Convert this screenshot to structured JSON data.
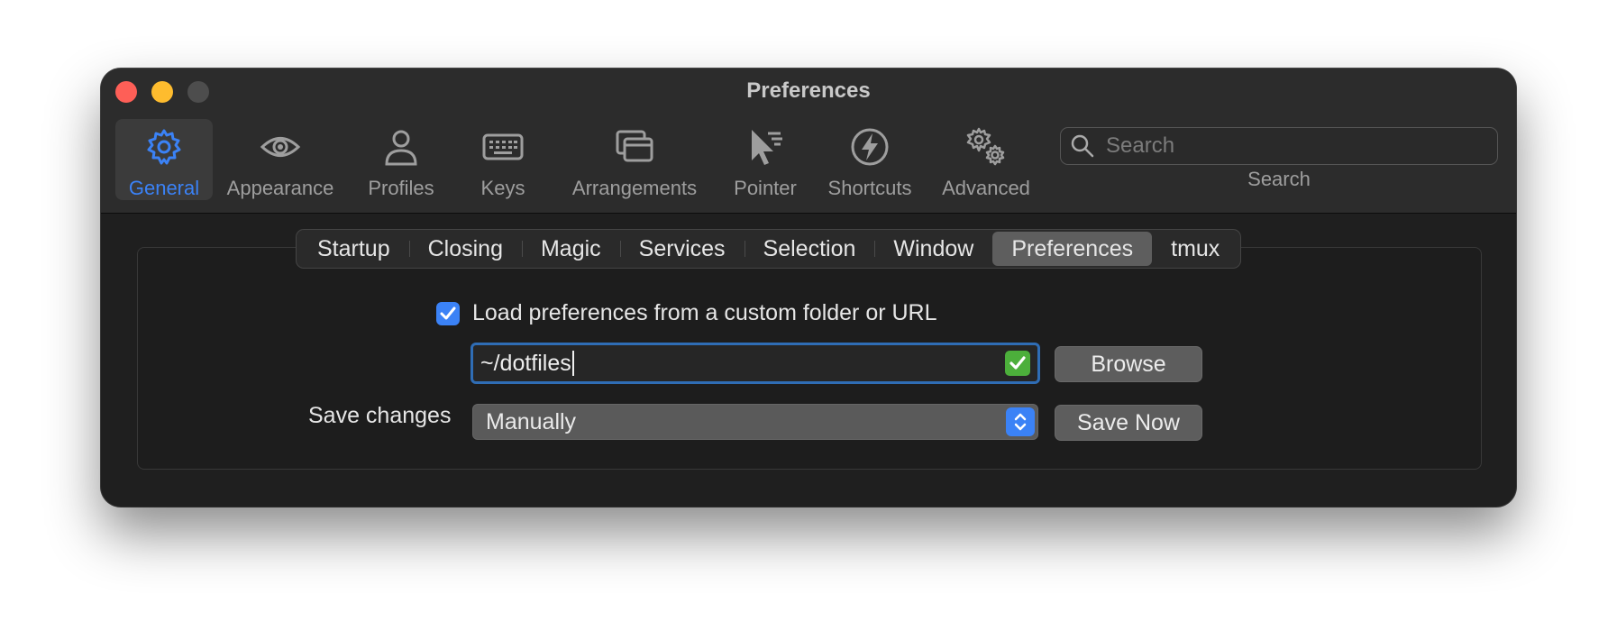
{
  "window": {
    "title": "Preferences"
  },
  "toolbar": {
    "items": [
      {
        "label": "General",
        "icon": "gear-icon",
        "active": true
      },
      {
        "label": "Appearance",
        "icon": "eye-icon"
      },
      {
        "label": "Profiles",
        "icon": "person-icon"
      },
      {
        "label": "Keys",
        "icon": "keyboard-icon"
      },
      {
        "label": "Arrangements",
        "icon": "windows-icon"
      },
      {
        "label": "Pointer",
        "icon": "pointer-icon"
      },
      {
        "label": "Shortcuts",
        "icon": "lightning-icon"
      },
      {
        "label": "Advanced",
        "icon": "gears-icon"
      }
    ],
    "search": {
      "placeholder": "Search",
      "caption": "Search"
    }
  },
  "subtabs": {
    "items": [
      "Startup",
      "Closing",
      "Magic",
      "Services",
      "Selection",
      "Window",
      "Preferences",
      "tmux"
    ],
    "selected": "Preferences"
  },
  "prefs": {
    "load_custom_label": "Load preferences from a custom folder or URL",
    "load_custom_checked": true,
    "path_value": "~/dotfiles",
    "browse_label": "Browse",
    "save_changes_label": "Save changes",
    "save_changes_value": "Manually",
    "save_now_label": "Save Now"
  },
  "colors": {
    "accent": "#3b82f6",
    "window_bg": "#1f1f1f",
    "toolbar_bg": "#2c2c2c",
    "close": "#fe5f57",
    "minimize": "#febc2e",
    "zoom_disabled": "#4d4d4d",
    "valid_check": "#4caf3b"
  }
}
